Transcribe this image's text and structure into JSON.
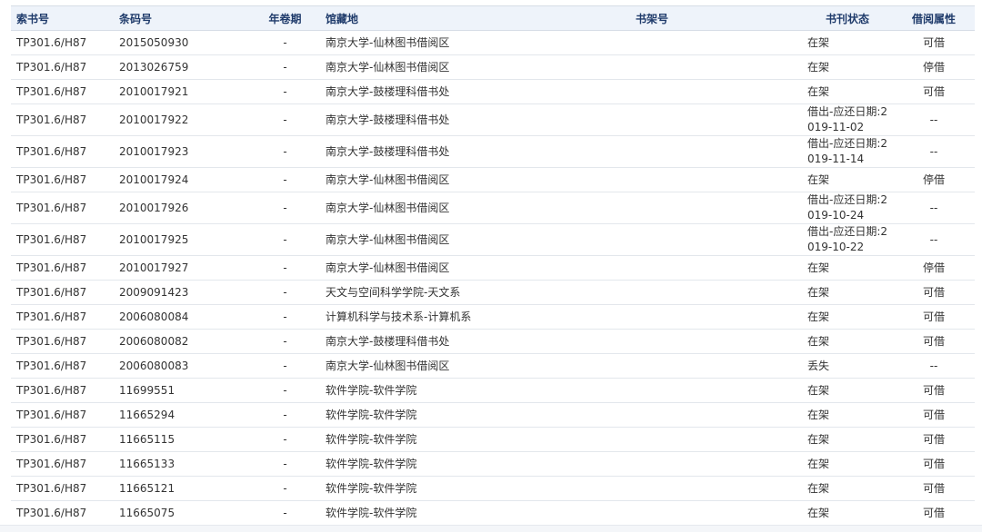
{
  "columns": {
    "call_no": "索书号",
    "barcode": "条码号",
    "volume": "年卷期",
    "location": "馆藏地",
    "shelf_no": "书架号",
    "status": "书刊状态",
    "loan_type": "借阅属性"
  },
  "rows": [
    {
      "call_no": "TP301.6/H87",
      "barcode": "2015050930",
      "volume": "-",
      "location": "南京大学-仙林图书借阅区",
      "shelf_no": "",
      "status": "在架",
      "loan_type": "可借"
    },
    {
      "call_no": "TP301.6/H87",
      "barcode": "2013026759",
      "volume": "-",
      "location": "南京大学-仙林图书借阅区",
      "shelf_no": "",
      "status": "在架",
      "loan_type": "停借"
    },
    {
      "call_no": "TP301.6/H87",
      "barcode": "2010017921",
      "volume": "-",
      "location": "南京大学-鼓楼理科借书处",
      "shelf_no": "",
      "status": "在架",
      "loan_type": "可借"
    },
    {
      "call_no": "TP301.6/H87",
      "barcode": "2010017922",
      "volume": "-",
      "location": "南京大学-鼓楼理科借书处",
      "shelf_no": "",
      "status": "借出-应还日期:2019-11-02",
      "loan_type": "--"
    },
    {
      "call_no": "TP301.6/H87",
      "barcode": "2010017923",
      "volume": "-",
      "location": "南京大学-鼓楼理科借书处",
      "shelf_no": "",
      "status": "借出-应还日期:2019-11-14",
      "loan_type": "--"
    },
    {
      "call_no": "TP301.6/H87",
      "barcode": "2010017924",
      "volume": "-",
      "location": "南京大学-仙林图书借阅区",
      "shelf_no": "",
      "status": "在架",
      "loan_type": "停借"
    },
    {
      "call_no": "TP301.6/H87",
      "barcode": "2010017926",
      "volume": "-",
      "location": "南京大学-仙林图书借阅区",
      "shelf_no": "",
      "status": "借出-应还日期:2019-10-24",
      "loan_type": "--"
    },
    {
      "call_no": "TP301.6/H87",
      "barcode": "2010017925",
      "volume": "-",
      "location": "南京大学-仙林图书借阅区",
      "shelf_no": "",
      "status": "借出-应还日期:2019-10-22",
      "loan_type": "--"
    },
    {
      "call_no": "TP301.6/H87",
      "barcode": "2010017927",
      "volume": "-",
      "location": "南京大学-仙林图书借阅区",
      "shelf_no": "",
      "status": "在架",
      "loan_type": "停借"
    },
    {
      "call_no": "TP301.6/H87",
      "barcode": "2009091423",
      "volume": "-",
      "location": "天文与空间科学学院-天文系",
      "shelf_no": "",
      "status": "在架",
      "loan_type": "可借"
    },
    {
      "call_no": "TP301.6/H87",
      "barcode": "2006080084",
      "volume": "-",
      "location": "计算机科学与技术系-计算机系",
      "shelf_no": "",
      "status": "在架",
      "loan_type": "可借"
    },
    {
      "call_no": "TP301.6/H87",
      "barcode": "2006080082",
      "volume": "-",
      "location": "南京大学-鼓楼理科借书处",
      "shelf_no": "",
      "status": "在架",
      "loan_type": "可借"
    },
    {
      "call_no": "TP301.6/H87",
      "barcode": "2006080083",
      "volume": "-",
      "location": "南京大学-仙林图书借阅区",
      "shelf_no": "",
      "status": "丢失",
      "loan_type": "--"
    },
    {
      "call_no": "TP301.6/H87",
      "barcode": "11699551",
      "volume": "-",
      "location": "软件学院-软件学院",
      "shelf_no": "",
      "status": "在架",
      "loan_type": "可借"
    },
    {
      "call_no": "TP301.6/H87",
      "barcode": "11665294",
      "volume": "-",
      "location": "软件学院-软件学院",
      "shelf_no": "",
      "status": "在架",
      "loan_type": "可借"
    },
    {
      "call_no": "TP301.6/H87",
      "barcode": "11665115",
      "volume": "-",
      "location": "软件学院-软件学院",
      "shelf_no": "",
      "status": "在架",
      "loan_type": "可借"
    },
    {
      "call_no": "TP301.6/H87",
      "barcode": "11665133",
      "volume": "-",
      "location": "软件学院-软件学院",
      "shelf_no": "",
      "status": "在架",
      "loan_type": "可借"
    },
    {
      "call_no": "TP301.6/H87",
      "barcode": "11665121",
      "volume": "-",
      "location": "软件学院-软件学院",
      "shelf_no": "",
      "status": "在架",
      "loan_type": "可借"
    },
    {
      "call_no": "TP301.6/H87",
      "barcode": "11665075",
      "volume": "-",
      "location": "软件学院-软件学院",
      "shelf_no": "",
      "status": "在架",
      "loan_type": "可借"
    }
  ]
}
